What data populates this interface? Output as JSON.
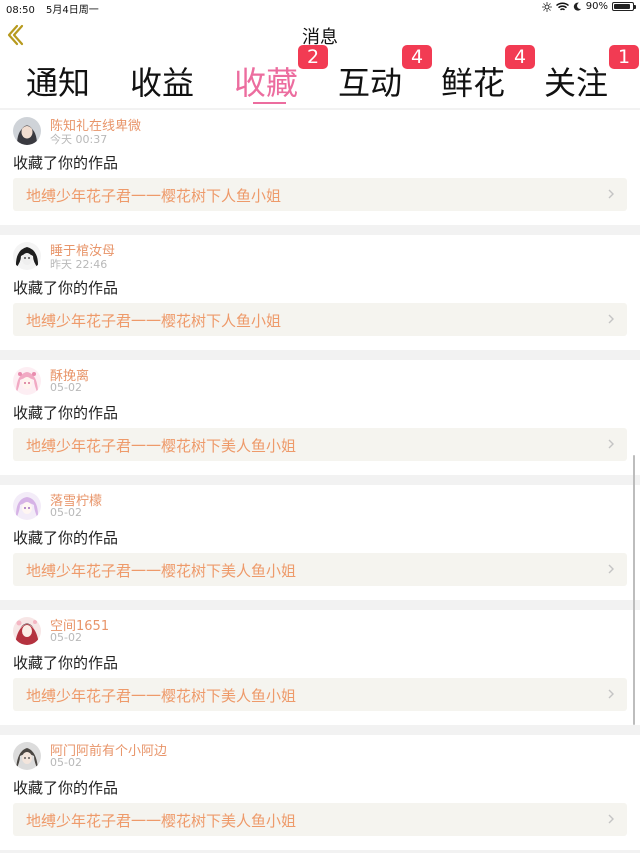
{
  "status_bar": {
    "time": "08:50",
    "date": "5月4日周一",
    "battery_percent": "90%",
    "battery_level": 0.9
  },
  "nav": {
    "title": "消息"
  },
  "tabs": [
    {
      "label": "通知",
      "badge": ""
    },
    {
      "label": "收益",
      "badge": ""
    },
    {
      "label": "收藏",
      "badge": "2",
      "active": true
    },
    {
      "label": "互动",
      "badge": "4"
    },
    {
      "label": "鲜花",
      "badge": "4"
    },
    {
      "label": "关注",
      "badge": "1"
    }
  ],
  "notifications": [
    {
      "user": "陈知礼在线卑微",
      "time": "今天 00:37",
      "action": "收藏了你的作品",
      "work": "地缚少年花子君一一樱花树下人鱼小姐"
    },
    {
      "user": "睡于棺汝母",
      "time": "昨天 22:46",
      "action": "收藏了你的作品",
      "work": "地缚少年花子君一一樱花树下人鱼小姐"
    },
    {
      "user": "酥挽离",
      "time": "05-02",
      "action": "收藏了你的作品",
      "work": "地缚少年花子君一一樱花树下美人鱼小姐"
    },
    {
      "user": "落雪柠檬",
      "time": "05-02",
      "action": "收藏了你的作品",
      "work": "地缚少年花子君一一樱花树下美人鱼小姐"
    },
    {
      "user": "空间1651",
      "time": "05-02",
      "action": "收藏了你的作品",
      "work": "地缚少年花子君一一樱花树下美人鱼小姐"
    },
    {
      "user": "阿门阿前有个小阿边",
      "time": "05-02",
      "action": "收藏了你的作品",
      "work": "地缚少年花子君一一樱花树下美人鱼小姐"
    }
  ],
  "colors": {
    "accent": "#ec6d9f",
    "badge": "#f23b53",
    "username": "#e8956a",
    "work_title": "#ee9a6a",
    "back_arrow": "#b79a1e"
  }
}
